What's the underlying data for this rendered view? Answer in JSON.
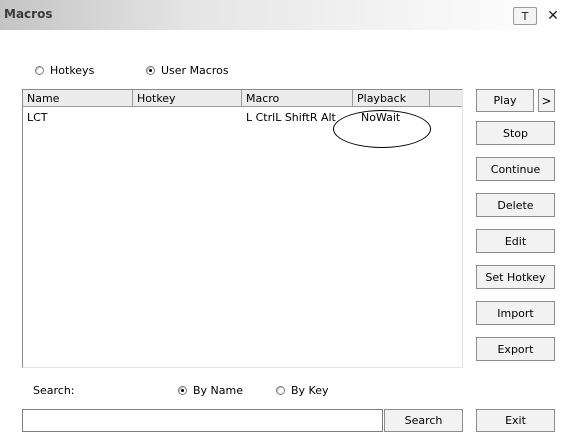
{
  "window": {
    "title": "Macros",
    "pin_glyph": "T",
    "close_glyph": "✕"
  },
  "mode_selector": {
    "options": [
      {
        "label": "Hotkeys",
        "checked": false
      },
      {
        "label": "User Macros",
        "checked": true
      }
    ]
  },
  "macro_list": {
    "columns": [
      "Name",
      "Hotkey",
      "Macro",
      "Playback",
      ""
    ],
    "rows": [
      {
        "name": "LCT",
        "hotkey": "",
        "macro": "L CtrlL ShiftR Alt",
        "playback": "NoWait"
      }
    ]
  },
  "annotation": {
    "shape": "ellipse",
    "circled_value": "NoWait",
    "color": "#000000"
  },
  "actions": {
    "play": "Play",
    "expand": ">",
    "stop": "Stop",
    "continue": "Continue",
    "delete": "Delete",
    "edit": "Edit",
    "set_hotkey": "Set Hotkey",
    "import": "Import",
    "export": "Export",
    "exit": "Exit"
  },
  "search": {
    "label": "Search:",
    "options": [
      {
        "label": "By Name",
        "checked": true
      },
      {
        "label": "By Key",
        "checked": false
      }
    ],
    "value": "",
    "button": "Search"
  }
}
